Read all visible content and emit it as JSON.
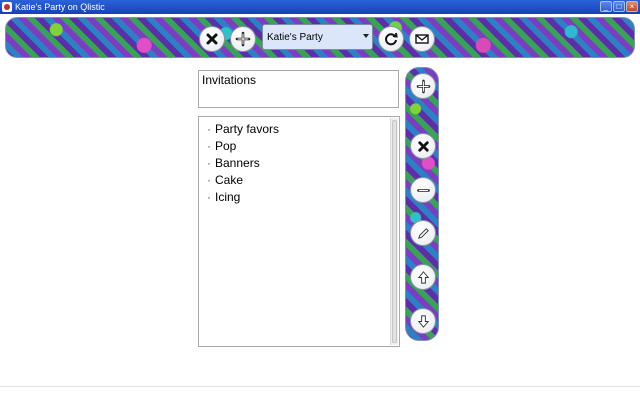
{
  "window": {
    "title": "Katie's Party on Qlistic"
  },
  "toolbar": {
    "delete_list_icon": "close-icon",
    "add_list_icon": "plus-icon",
    "selected_list": "Katie's Party",
    "refresh_icon": "refresh-icon",
    "email_icon": "envelope-icon"
  },
  "list": {
    "title": "Invitations",
    "items": [
      {
        "label": "Party favors"
      },
      {
        "label": "Pop"
      },
      {
        "label": "Banners"
      },
      {
        "label": "Cake"
      },
      {
        "label": "Icing"
      }
    ]
  },
  "side_toolbar": {
    "icons": [
      "plus-icon",
      "close-icon",
      "minus-icon",
      "pencil-icon",
      "arrow-up-icon",
      "arrow-down-icon"
    ]
  }
}
